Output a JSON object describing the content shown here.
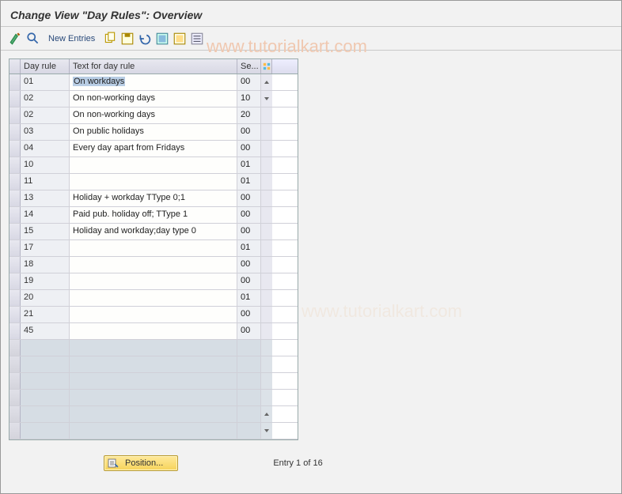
{
  "title": "Change View \"Day Rules\": Overview",
  "toolbar": {
    "new_entries": "New Entries"
  },
  "watermark": "www.tutorialkart.com",
  "columns": {
    "day_rule": "Day rule",
    "text": "Text for day rule",
    "se": "Se..."
  },
  "rows": [
    {
      "day": "01",
      "text": "On workdays",
      "se": "00",
      "selected": true
    },
    {
      "day": "02",
      "text": "On non-working days",
      "se": "10"
    },
    {
      "day": "02",
      "text": "On non-working days",
      "se": "20"
    },
    {
      "day": "03",
      "text": "On public holidays",
      "se": "00"
    },
    {
      "day": "04",
      "text": "Every day apart from Fridays",
      "se": "00"
    },
    {
      "day": "10",
      "text": "",
      "se": "01"
    },
    {
      "day": "11",
      "text": "",
      "se": "01"
    },
    {
      "day": "13",
      "text": "Holiday + workday TType 0;1",
      "se": "00"
    },
    {
      "day": "14",
      "text": "Paid pub. holiday off; TType 1",
      "se": "00"
    },
    {
      "day": "15",
      "text": "Holiday and workday;day type 0",
      "se": "00"
    },
    {
      "day": "17",
      "text": "",
      "se": "01"
    },
    {
      "day": "18",
      "text": "",
      "se": "00"
    },
    {
      "day": "19",
      "text": "",
      "se": "00"
    },
    {
      "day": "20",
      "text": "",
      "se": "01"
    },
    {
      "day": "21",
      "text": "",
      "se": "00"
    },
    {
      "day": "45",
      "text": "",
      "se": "00"
    }
  ],
  "empty_rows": 6,
  "footer": {
    "position_btn": "Position...",
    "entry_status": "Entry 1 of 16"
  }
}
